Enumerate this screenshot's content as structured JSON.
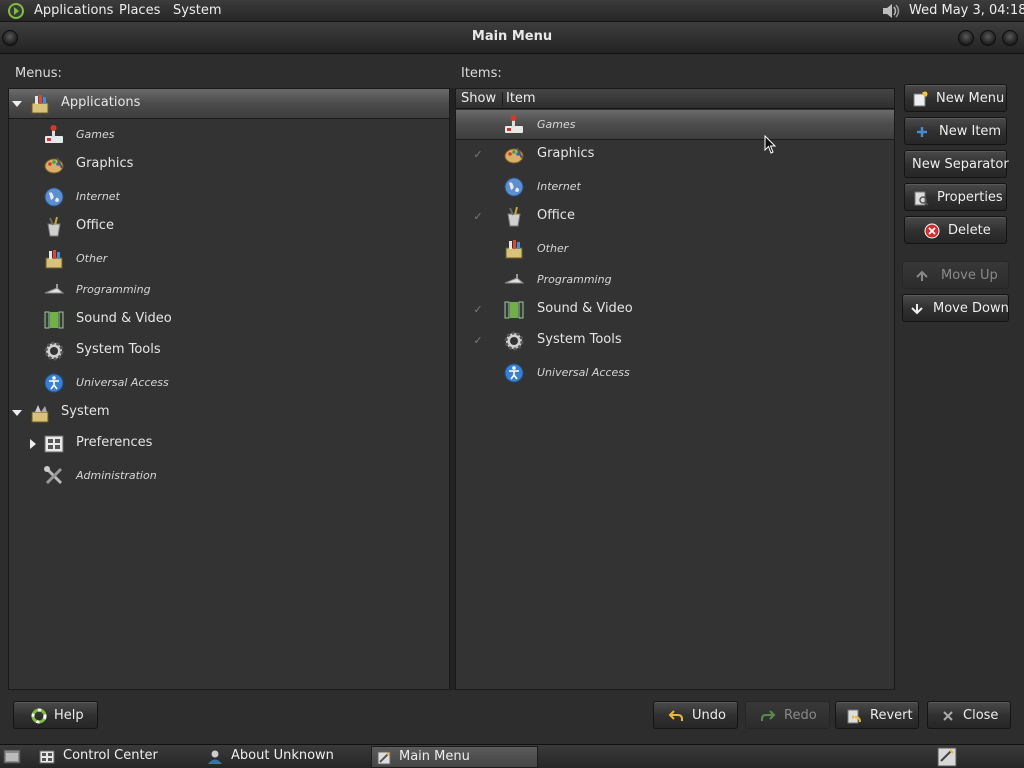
{
  "top_panel": {
    "menus": [
      "Applications",
      "Places",
      "System"
    ],
    "clock": "Wed May  3, 04:18"
  },
  "window": {
    "title": "Main Menu"
  },
  "menus_pane": {
    "label": "Menus:",
    "rows": [
      {
        "label": "Applications",
        "icon": "applications-icon",
        "expanded": true
      },
      {
        "label": "Games",
        "icon": "games-icon"
      },
      {
        "label": "Graphics",
        "icon": "graphics-icon"
      },
      {
        "label": "Internet",
        "icon": "internet-icon"
      },
      {
        "label": "Office",
        "icon": "office-icon"
      },
      {
        "label": "Other",
        "icon": "other-icon"
      },
      {
        "label": "Programming",
        "icon": "programming-icon"
      },
      {
        "label": "Sound & Video",
        "icon": "sound-video-icon"
      },
      {
        "label": "System Tools",
        "icon": "system-tools-icon"
      },
      {
        "label": "Universal Access",
        "icon": "universal-access-icon"
      },
      {
        "label": "System",
        "icon": "system-icon",
        "expanded": true
      },
      {
        "label": "Preferences",
        "icon": "preferences-icon",
        "expanded": false
      },
      {
        "label": "Administration",
        "icon": "administration-icon"
      }
    ]
  },
  "items_pane": {
    "label": "Items:",
    "columns": {
      "show": "Show",
      "item": "Item"
    },
    "rows": [
      {
        "label": "Games",
        "icon": "games-icon",
        "shown": false
      },
      {
        "label": "Graphics",
        "icon": "graphics-icon",
        "shown": true
      },
      {
        "label": "Internet",
        "icon": "internet-icon",
        "shown": false
      },
      {
        "label": "Office",
        "icon": "office-icon",
        "shown": true
      },
      {
        "label": "Other",
        "icon": "other-icon",
        "shown": false
      },
      {
        "label": "Programming",
        "icon": "programming-icon",
        "shown": false
      },
      {
        "label": "Sound & Video",
        "icon": "sound-video-icon",
        "shown": true
      },
      {
        "label": "System Tools",
        "icon": "system-tools-icon",
        "shown": true
      },
      {
        "label": "Universal Access",
        "icon": "universal-access-icon",
        "shown": false
      }
    ]
  },
  "side_buttons": {
    "new_menu": "New Menu",
    "new_item": "New Item",
    "new_separator": "New Separator",
    "properties": "Properties",
    "delete": "Delete",
    "move_up": "Move Up",
    "move_down": "Move Down"
  },
  "bottom_buttons": {
    "help": "Help",
    "undo": "Undo",
    "redo": "Redo",
    "revert": "Revert",
    "close": "Close"
  },
  "taskbar": {
    "tasks": [
      "Control Center",
      "About Unknown",
      "Main Menu"
    ]
  },
  "colors": {
    "background": "#2d2d2d",
    "pane": "#333333",
    "selection": "#5a5a5a",
    "text": "#e6e6e6",
    "delete_icon": "#d22d2d",
    "link_blue": "#3a7fd0"
  }
}
